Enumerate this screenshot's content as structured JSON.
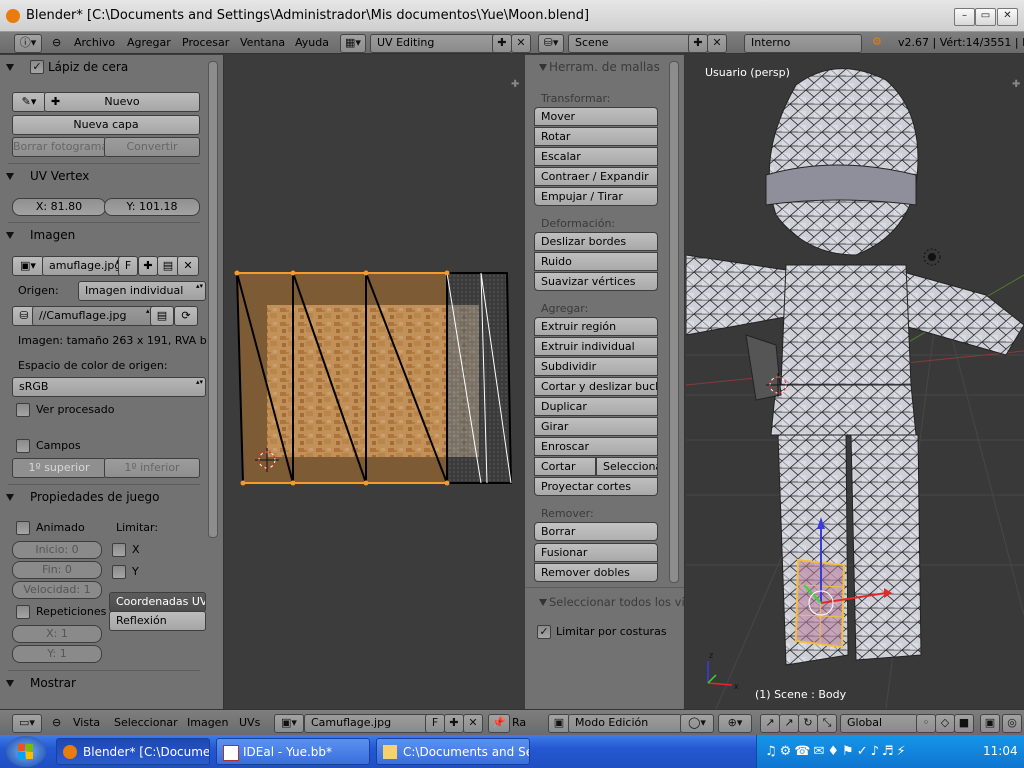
{
  "window": {
    "title": "Blender* [C:\\Documents and Settings\\Administrador\\Mis documentos\\Yue\\Moon.blend]",
    "controls": [
      "–",
      "▭",
      "✕"
    ]
  },
  "top_header": {
    "menus": [
      "Archivo",
      "Agregar",
      "Procesar",
      "Ventana",
      "Ayuda"
    ],
    "screen_layout": "UV Editing",
    "scene": "Scene",
    "render_engine": "Interno",
    "version_info": "v2.67 | Vért:14/3551 | E"
  },
  "grease_pencil": {
    "title": "Lápiz de cera",
    "new_label": "Nuevo",
    "new_layer_label": "Nueva capa",
    "delete_frame_label": "Borrar fotograma",
    "convert_label": "Convertir"
  },
  "uv_vertex": {
    "title": "UV Vertex",
    "x": "X: 81.80",
    "y": "Y: 101.18"
  },
  "image_panel": {
    "title": "Imagen",
    "image_name": "amuflage.jpg",
    "fake_user": "F",
    "origin_label": "Origen:",
    "origin_value": "Imagen individual",
    "filepath": "//Camuflage.jpg",
    "info": "Imagen: tamaño 263 x 191, RVA b",
    "colorspace_label": "Espacio de color de origen:",
    "colorspace_value": "sRGB",
    "view_processed": "Ver procesado",
    "fields": "Campos",
    "upper_first": "1º superior",
    "lower_first": "1º inferior"
  },
  "game_props": {
    "title": "Propiedades de juego",
    "animated": "Animado",
    "limit_label": "Limitar:",
    "start": "Inicio: 0",
    "end": "Fin: 0",
    "speed": "Velocidad: 1",
    "limit_x": "X",
    "limit_y": "Y",
    "repeat": "Repeticiones",
    "repeat_x": "X: 1",
    "repeat_y": "Y: 1",
    "uv_coords": "Coordenadas UV",
    "reflection": "Reflexión"
  },
  "display": {
    "title": "Mostrar"
  },
  "tool_shelf": {
    "title": "Herram. de mallas",
    "transform_label": "Transformar:",
    "transform": [
      "Mover",
      "Rotar",
      "Escalar",
      "Contraer / Expandir",
      "Empujar / Tirar"
    ],
    "deform_label": "Deformación:",
    "deform": [
      "Deslizar bordes",
      "Ruido",
      "Suavizar vértices"
    ],
    "add_label": "Agregar:",
    "add": [
      "Extruir región",
      "Extruir individual",
      "Subdividir",
      "Cortar y deslizar bucle",
      "Duplicar",
      "Girar",
      "Enroscar"
    ],
    "cut": "Cortar",
    "cut_select": "Selecciona",
    "project_cuts": "Proyectar cortes",
    "remove_label": "Remover:",
    "remove": [
      "Borrar",
      "Fusionar",
      "Remover dobles"
    ],
    "select_all_title": "Seleccionar todos los vi",
    "limit_seams": "Limitar por costuras"
  },
  "viewport": {
    "view_label": "Usuario (persp)",
    "scene_label": "(1) Scene : Body"
  },
  "bottom_header": {
    "uv_menus": [
      "Vista",
      "Seleccionar",
      "Imagen",
      "UVs"
    ],
    "image_field": "Camuflage.jpg",
    "fake_user": "F",
    "mode_cut": "Ra",
    "mode": "Modo Edición",
    "orientation": "Global"
  },
  "taskbar": {
    "tasks": [
      "Blender* [C:\\Documen...",
      "IDEal - Yue.bb*",
      "C:\\Documents and Set..."
    ],
    "clock": "11:04"
  }
}
